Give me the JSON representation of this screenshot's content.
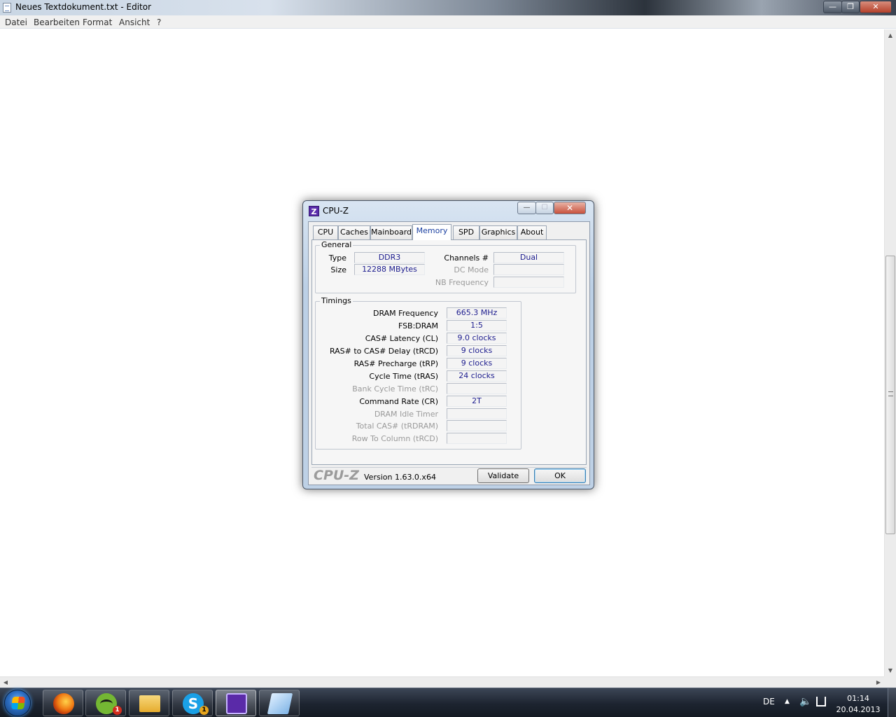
{
  "notepad": {
    "title": "Neues Textdokument.txt - Editor",
    "menu": [
      "Datei",
      "Bearbeiten",
      "Format",
      "Ansicht",
      "?"
    ],
    "window_buttons": {
      "minimize": "—",
      "maximize": "❐",
      "close": "✕"
    }
  },
  "cpuz": {
    "title": "CPU-Z",
    "icon_letter": "Z",
    "window_buttons": {
      "minimize": "—",
      "maximize": "☐",
      "close": "✕"
    },
    "tabs": [
      "CPU",
      "Caches",
      "Mainboard",
      "Memory",
      "SPD",
      "Graphics",
      "About"
    ],
    "selected_tab": "Memory",
    "general": {
      "title": "General",
      "type_label": "Type",
      "type_value": "DDR3",
      "size_label": "Size",
      "size_value": "12288 MBytes",
      "channels_label": "Channels #",
      "channels_value": "Dual",
      "dcmode_label": "DC Mode",
      "dcmode_value": "",
      "nbfreq_label": "NB Frequency",
      "nbfreq_value": ""
    },
    "timings": {
      "title": "Timings",
      "rows": [
        {
          "label": "DRAM Frequency",
          "value": "665.3 MHz",
          "enabled": true
        },
        {
          "label": "FSB:DRAM",
          "value": "1:5",
          "enabled": true
        },
        {
          "label": "CAS# Latency (CL)",
          "value": "9.0 clocks",
          "enabled": true
        },
        {
          "label": "RAS# to CAS# Delay (tRCD)",
          "value": "9 clocks",
          "enabled": true
        },
        {
          "label": "RAS# Precharge (tRP)",
          "value": "9 clocks",
          "enabled": true
        },
        {
          "label": "Cycle Time (tRAS)",
          "value": "24 clocks",
          "enabled": true
        },
        {
          "label": "Bank Cycle Time (tRC)",
          "value": "",
          "enabled": false
        },
        {
          "label": "Command Rate (CR)",
          "value": "2T",
          "enabled": true
        },
        {
          "label": "DRAM Idle Timer",
          "value": "",
          "enabled": false
        },
        {
          "label": "Total CAS# (tRDRAM)",
          "value": "",
          "enabled": false
        },
        {
          "label": "Row To Column (tRCD)",
          "value": "",
          "enabled": false
        }
      ]
    },
    "footer": {
      "logo": "CPU-Z",
      "version": "Version 1.63.0.x64",
      "validate_label": "Validate",
      "ok_label": "OK"
    }
  },
  "taskbar": {
    "badges": {
      "spotify": "1",
      "skype": "1"
    },
    "skype_letter": "S",
    "tray": {
      "language": "DE",
      "time": "01:14",
      "date": "20.04.2013"
    }
  },
  "scrollbar": {
    "up": "▲",
    "down": "▼",
    "left": "◀",
    "right": "▶"
  }
}
